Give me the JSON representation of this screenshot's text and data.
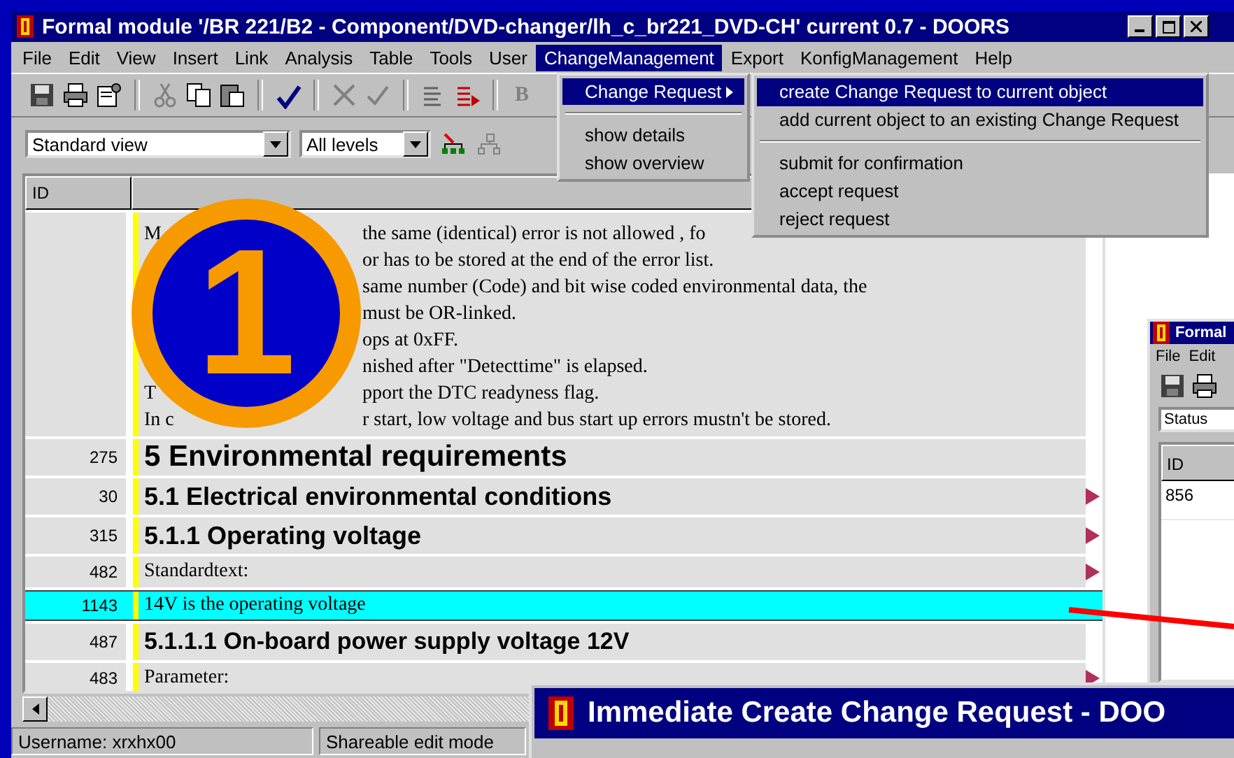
{
  "window": {
    "title": "Formal module '/BR 221/B2 - Component/DVD-changer/lh_c_br221_DVD-CH' current 0.7 - DOORS"
  },
  "menu_bar": [
    {
      "label": "File",
      "selected": false
    },
    {
      "label": "Edit",
      "selected": false
    },
    {
      "label": "View",
      "selected": false
    },
    {
      "label": "Insert",
      "selected": false
    },
    {
      "label": "Link",
      "selected": false
    },
    {
      "label": "Analysis",
      "selected": false
    },
    {
      "label": "Table",
      "selected": false
    },
    {
      "label": "Tools",
      "selected": false
    },
    {
      "label": "User",
      "selected": false
    },
    {
      "label": "ChangeManagement",
      "selected": true
    },
    {
      "label": "Export",
      "selected": false
    },
    {
      "label": "KonfigManagement",
      "selected": false
    },
    {
      "label": "Help",
      "selected": false
    }
  ],
  "toolbar": {
    "bold_button": "B",
    "view_select": "Standard view",
    "level_select": "All levels"
  },
  "table": {
    "columns": [
      "ID"
    ],
    "rows": [
      {
        "kind": "text",
        "id": "",
        "selected": false,
        "linked": false,
        "lines": [
          {
            "lead": "M",
            "text": "the same (identical) error is not allowed , fo"
          },
          {
            "text": "or has to be stored at the end of the error list."
          },
          {
            "text": "same number (Code) and bit wise coded environmental data, the"
          },
          {
            "text": "must be OR-linked."
          },
          {
            "text": "ops at 0xFF."
          },
          {
            "text": "nished after \"Detecttime\" is elapsed."
          },
          {
            "lead": "T",
            "text": "pport the DTC readyness flag."
          },
          {
            "lead": "In c",
            "text": "r start, low voltage and bus start up errors mustn't be stored."
          }
        ]
      },
      {
        "kind": "h1",
        "id": "275",
        "text": "5 Environmental requirements",
        "selected": false,
        "linked": false
      },
      {
        "kind": "h2",
        "id": "30",
        "text": "5.1 Electrical environmental conditions",
        "selected": false,
        "linked": true
      },
      {
        "kind": "h2",
        "id": "315",
        "text": "5.1.1 Operating voltage",
        "selected": false,
        "linked": true
      },
      {
        "kind": "body",
        "id": "482",
        "text": "Standardtext:",
        "selected": false,
        "linked": true
      },
      {
        "kind": "body",
        "id": "1143",
        "text": "14V is the operating voltage",
        "selected": true,
        "linked": false
      },
      {
        "kind": "h3",
        "id": "487",
        "text": "5.1.1.1 On-board power supply voltage 12V",
        "selected": false,
        "linked": false
      },
      {
        "kind": "body",
        "id": "483",
        "text": "Parameter:",
        "selected": false,
        "linked": true
      }
    ]
  },
  "menu": {
    "items": [
      {
        "kind": "item",
        "label": "Change Request",
        "selected": true,
        "has_submenu": true
      },
      {
        "kind": "separator"
      },
      {
        "kind": "item",
        "label": "show details",
        "selected": false,
        "has_submenu": false
      },
      {
        "kind": "item",
        "label": "show overview",
        "selected": false,
        "has_submenu": false
      }
    ]
  },
  "submenu": {
    "items": [
      {
        "kind": "item",
        "label": "create Change Request to current object",
        "selected": true
      },
      {
        "kind": "item",
        "label": "add current object to an existing Change Request",
        "selected": false
      },
      {
        "kind": "separator"
      },
      {
        "kind": "item",
        "label": "submit for confirmation",
        "selected": false
      },
      {
        "kind": "item",
        "label": "accept request",
        "selected": false
      },
      {
        "kind": "item",
        "label": "reject request",
        "selected": false
      }
    ]
  },
  "side_window": {
    "title": "Formal",
    "menu": [
      "File",
      "Edit"
    ],
    "view_select": "Status",
    "columns": [
      "ID"
    ],
    "rows": [
      "856"
    ]
  },
  "dialog": {
    "title": "Immediate Create Change Request - DOO"
  },
  "status_bar": [
    "Username: xrxhx00",
    "Shareable edit mode"
  ],
  "annotation": {
    "label": "1"
  }
}
